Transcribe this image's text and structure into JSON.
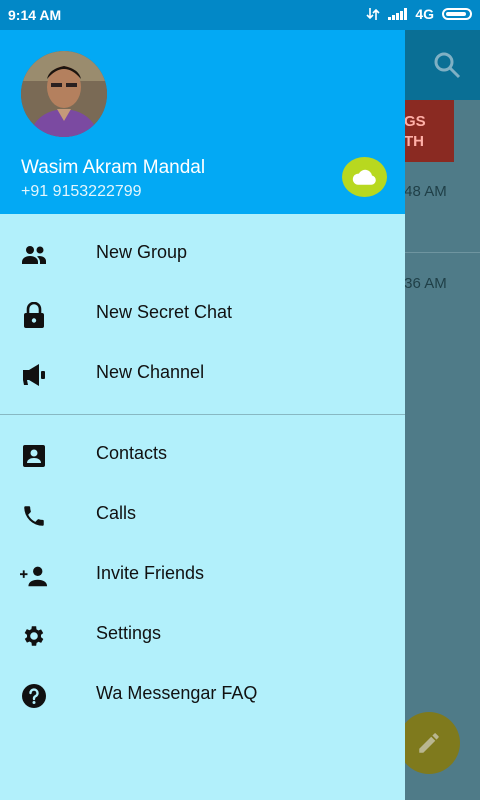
{
  "status_bar": {
    "time": "9:14 AM",
    "network": "4G"
  },
  "background": {
    "thumb_text": "GS\nTH",
    "times": [
      ":48 AM",
      ":36 AM"
    ]
  },
  "drawer": {
    "user": {
      "name": "Wasim Akram Mandal",
      "phone": "+91 9153222799"
    },
    "menu_primary": [
      {
        "icon": "group-icon",
        "label": "New Group"
      },
      {
        "icon": "lock-icon",
        "label": "New Secret Chat"
      },
      {
        "icon": "megaphone-icon",
        "label": "New Channel"
      }
    ],
    "menu_secondary": [
      {
        "icon": "contacts-icon",
        "label": "Contacts"
      },
      {
        "icon": "phone-icon",
        "label": "Calls"
      },
      {
        "icon": "add-person-icon",
        "label": "Invite Friends"
      },
      {
        "icon": "gear-icon",
        "label": "Settings"
      },
      {
        "icon": "help-icon",
        "label": "Wa Messengar FAQ"
      }
    ]
  },
  "colors": {
    "drawer_header": "#03a9f4",
    "drawer_bg": "#b2f0fb",
    "cloud_button": "#b8d81f",
    "status_bar": "#0288c7"
  }
}
